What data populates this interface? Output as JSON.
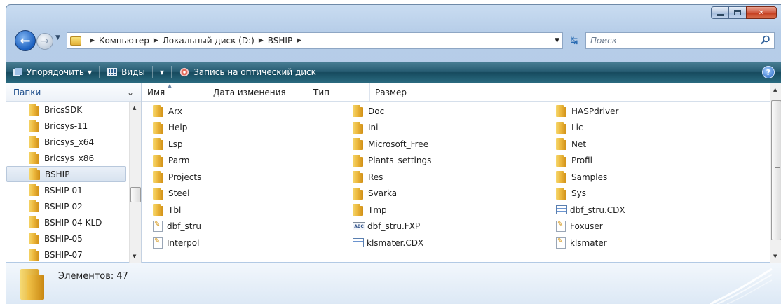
{
  "address": {
    "crumbs": [
      "Компьютер",
      "Локальный диск (D:)",
      "BSHIP"
    ]
  },
  "search": {
    "placeholder": "Поиск"
  },
  "toolbar": {
    "organize_label": "Упорядочить",
    "views_label": "Виды",
    "burn_label": "Запись на оптический диск",
    "help_label": "?"
  },
  "folders_pane": {
    "header": "Папки",
    "items": [
      "BricsSDK",
      "Bricsys-11",
      "Bricsys_x64",
      "Bricsys_x86",
      "BSHIP",
      "BSHIP-01",
      "BSHIP-02",
      "BSHIP-04 KLD",
      "BSHIP-05",
      "BSHIP-07"
    ],
    "selected": "BSHIP"
  },
  "columns": [
    "Имя",
    "Дата изменения",
    "Тип",
    "Размер"
  ],
  "files": {
    "col1": [
      {
        "name": "Arx",
        "type": "folder"
      },
      {
        "name": "Help",
        "type": "folder"
      },
      {
        "name": "Lsp",
        "type": "folder"
      },
      {
        "name": "Parm",
        "type": "folder"
      },
      {
        "name": "Projects",
        "type": "folder"
      },
      {
        "name": "Steel",
        "type": "folder"
      },
      {
        "name": "Tbl",
        "type": "folder"
      },
      {
        "name": "dbf_stru",
        "type": "doc"
      },
      {
        "name": "Interpol",
        "type": "doc"
      }
    ],
    "col2": [
      {
        "name": "Doc",
        "type": "folder"
      },
      {
        "name": "Ini",
        "type": "folder"
      },
      {
        "name": "Microsoft_Free",
        "type": "folder"
      },
      {
        "name": "Plants_settings",
        "type": "folder"
      },
      {
        "name": "Res",
        "type": "folder"
      },
      {
        "name": "Svarka",
        "type": "folder"
      },
      {
        "name": "Tmp",
        "type": "folder"
      },
      {
        "name": "dbf_stru.FXP",
        "type": "fxp"
      },
      {
        "name": "klsmater.CDX",
        "type": "cdx"
      }
    ],
    "col3": [
      {
        "name": "HASPdriver",
        "type": "folder"
      },
      {
        "name": "Lic",
        "type": "folder"
      },
      {
        "name": "Net",
        "type": "folder"
      },
      {
        "name": "Profil",
        "type": "folder"
      },
      {
        "name": "Samples",
        "type": "folder"
      },
      {
        "name": "Sys",
        "type": "folder"
      },
      {
        "name": "dbf_stru.CDX",
        "type": "cdx"
      },
      {
        "name": "Foxuser",
        "type": "doc"
      },
      {
        "name": "klsmater",
        "type": "doc"
      }
    ]
  },
  "status": {
    "count_label": "Элементов: 47"
  },
  "icons": {
    "fxp_badge": "ABC"
  }
}
